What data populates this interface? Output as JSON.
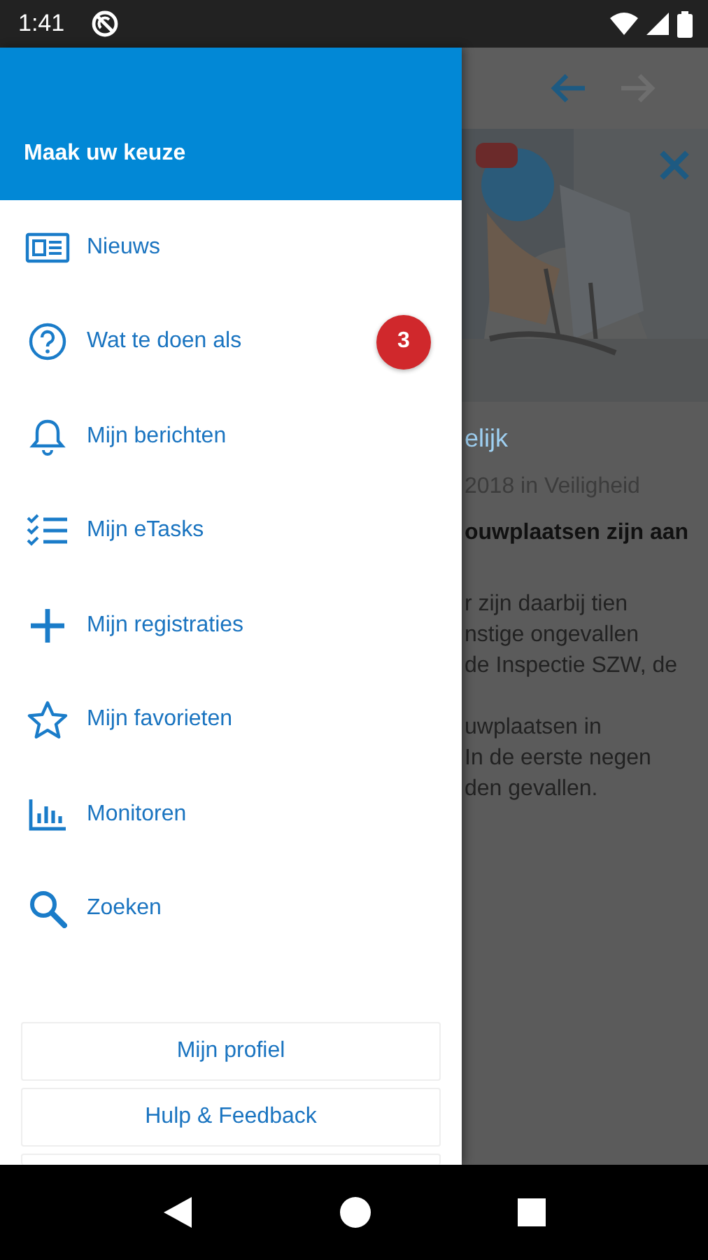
{
  "status_bar": {
    "time": "1:41"
  },
  "drawer": {
    "title": "Maak uw keuze",
    "items": [
      {
        "label": "Nieuws"
      },
      {
        "label": "Wat te doen als",
        "badge": "3"
      },
      {
        "label": "Mijn berichten"
      },
      {
        "label": "Mijn eTasks"
      },
      {
        "label": "Mijn registraties"
      },
      {
        "label": "Mijn favorieten"
      },
      {
        "label": "Monitoren"
      },
      {
        "label": "Zoeken"
      }
    ],
    "buttons": [
      "Mijn profiel",
      "Hulp & Feedback"
    ]
  },
  "article": {
    "title": "elijk",
    "meta": "2018 in Veiligheid",
    "lead": "ouwplaatsen zijn aan",
    "paragraphs": [
      [
        "r zijn daarbij tien",
        "nstige ongevallen",
        "de Inspectie SZW, de"
      ],
      [
        "uwplaatsen in",
        "In de eerste negen",
        "den gevallen."
      ]
    ]
  }
}
